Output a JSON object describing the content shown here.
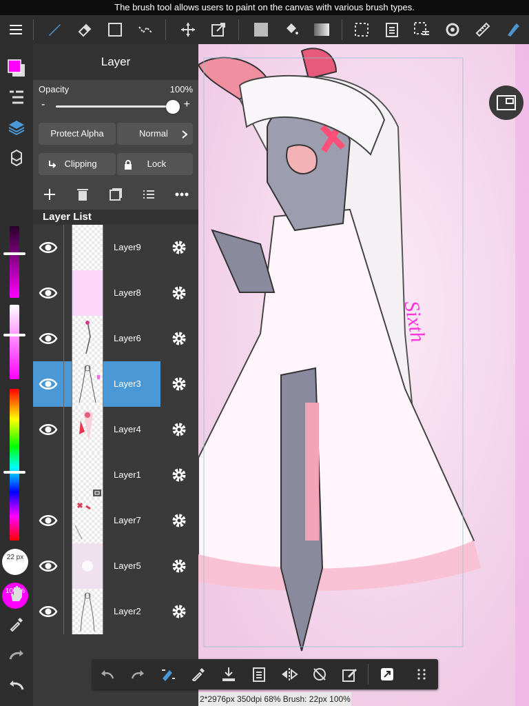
{
  "tooltip": "The brush tool allows users to paint on the canvas with various brush types.",
  "colors": {
    "foreground": "#ff00ff",
    "accent_selected": "#4a98d6"
  },
  "layer_panel": {
    "title": "Layer",
    "opacity_label": "Opacity",
    "opacity_value": "100%",
    "opacity_fraction": 1.0,
    "minus": "-",
    "plus": "+",
    "protect_alpha_label": "Protect Alpha",
    "blend_mode": "Normal",
    "clipping_label": "Clipping",
    "lock_label": "Lock",
    "list_header": "Layer List",
    "layers": [
      {
        "name": "Layer9",
        "visible": true,
        "selected": false
      },
      {
        "name": "Layer8",
        "visible": true,
        "selected": false
      },
      {
        "name": "Layer6",
        "visible": true,
        "selected": false
      },
      {
        "name": "Layer3",
        "visible": true,
        "selected": true
      },
      {
        "name": "Layer4",
        "visible": true,
        "selected": false
      },
      {
        "name": "Layer1",
        "visible": false,
        "selected": false
      },
      {
        "name": "Layer7",
        "visible": true,
        "selected": false
      },
      {
        "name": "Layer5",
        "visible": true,
        "selected": false
      },
      {
        "name": "Layer2",
        "visible": true,
        "selected": false
      }
    ]
  },
  "brush": {
    "size_text": "22 px",
    "opacity_text": "100 %"
  },
  "status_bar": "2*2976px 350dpi 68% Brush: 22px 100%",
  "canvas": {
    "signature_text": "Sixth"
  }
}
